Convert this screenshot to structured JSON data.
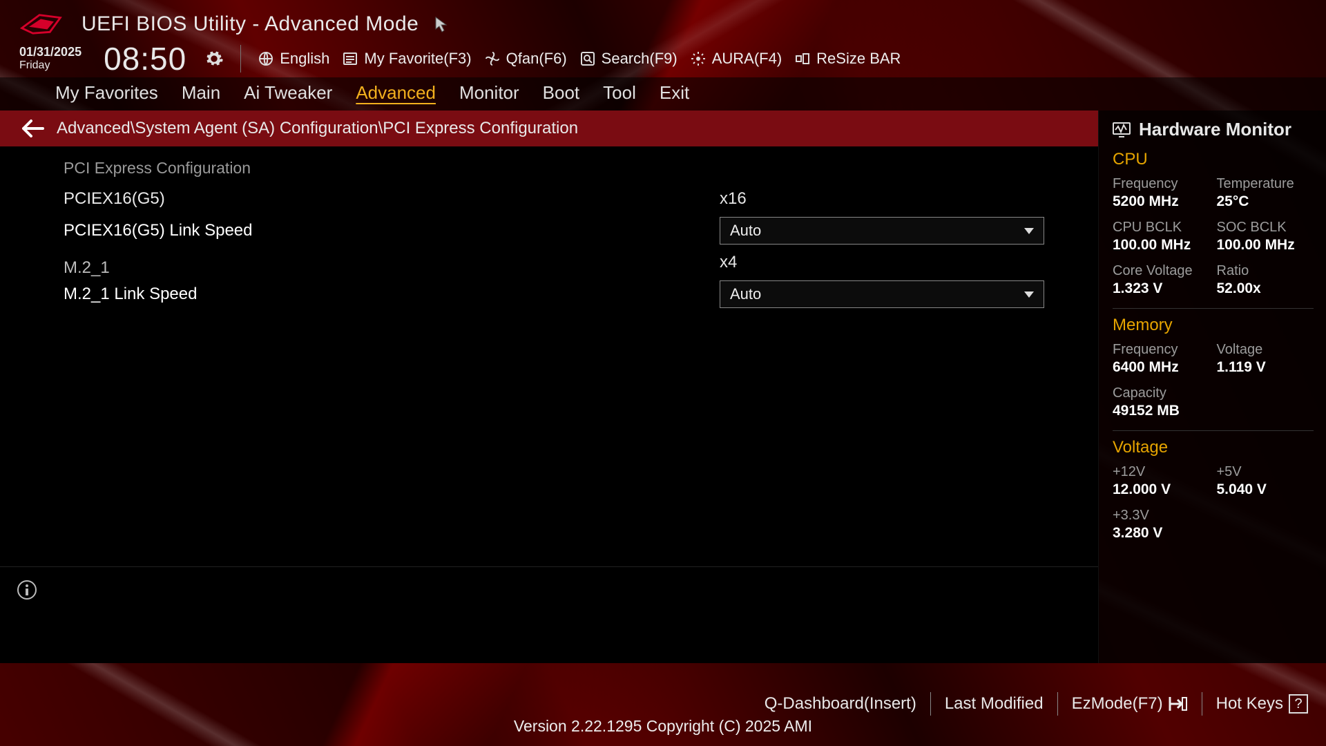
{
  "header": {
    "title": "UEFI BIOS Utility - Advanced Mode",
    "date": "01/31/2025",
    "day": "Friday",
    "time": "08:50"
  },
  "toolbar": {
    "language": "English",
    "favorite": "My Favorite(F3)",
    "qfan": "Qfan(F6)",
    "search": "Search(F9)",
    "aura": "AURA(F4)",
    "resize_bar": "ReSize BAR"
  },
  "tabs": [
    "My Favorites",
    "Main",
    "Ai Tweaker",
    "Advanced",
    "Monitor",
    "Boot",
    "Tool",
    "Exit"
  ],
  "active_tab_index": 3,
  "breadcrumb": "Advanced\\System Agent (SA) Configuration\\PCI Express Configuration",
  "page": {
    "section_title": "PCI Express Configuration",
    "rows": [
      {
        "type": "info",
        "label": "PCIEX16(G5)",
        "value": "x16"
      },
      {
        "type": "select",
        "label": "PCIEX16(G5) Link Speed",
        "value": "Auto"
      },
      {
        "type": "info",
        "label": "M.2_1",
        "value": "x4",
        "subhead": true
      },
      {
        "type": "select",
        "label": "M.2_1 Link Speed",
        "value": "Auto"
      }
    ]
  },
  "sidebar": {
    "title": "Hardware Monitor",
    "cpu": {
      "heading": "CPU",
      "items": [
        {
          "label": "Frequency",
          "value": "5200 MHz"
        },
        {
          "label": "Temperature",
          "value": "25°C"
        },
        {
          "label": "CPU BCLK",
          "value": "100.00 MHz"
        },
        {
          "label": "SOC BCLK",
          "value": "100.00 MHz"
        },
        {
          "label": "Core Voltage",
          "value": "1.323 V"
        },
        {
          "label": "Ratio",
          "value": "52.00x"
        }
      ]
    },
    "memory": {
      "heading": "Memory",
      "items": [
        {
          "label": "Frequency",
          "value": "6400 MHz"
        },
        {
          "label": "Voltage",
          "value": "1.119 V"
        },
        {
          "label": "Capacity",
          "value": "49152 MB"
        }
      ]
    },
    "voltage": {
      "heading": "Voltage",
      "items": [
        {
          "label": "+12V",
          "value": "12.000 V"
        },
        {
          "label": "+5V",
          "value": "5.040 V"
        },
        {
          "label": "+3.3V",
          "value": "3.280 V"
        }
      ]
    }
  },
  "footer": {
    "qdash": "Q-Dashboard(Insert)",
    "last_modified": "Last Modified",
    "ezmode": "EzMode(F7)",
    "hotkeys": "Hot Keys",
    "version": "Version 2.22.1295 Copyright (C) 2025 AMI"
  }
}
